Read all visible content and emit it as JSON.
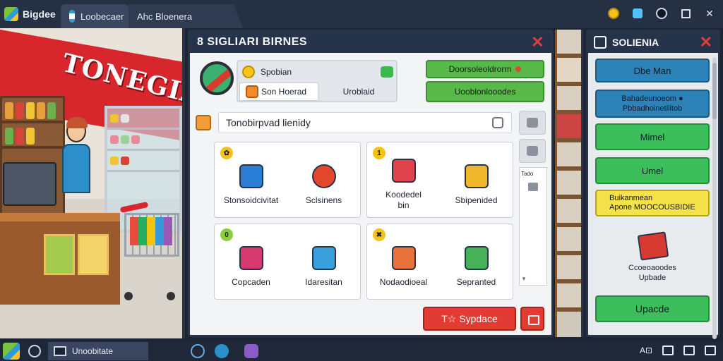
{
  "window": {
    "app_name": "Bigdee",
    "tabs": [
      {
        "label": "Loobecaer"
      },
      {
        "label": "Ahc Bloenera"
      }
    ],
    "controls": [
      "coin-icon",
      "puzzle-icon",
      "moon-icon",
      "maximize-icon",
      "close-icon"
    ]
  },
  "scene": {
    "store_sign": "TONEGIANA"
  },
  "dialog": {
    "title": "8 SIGLIARI BIRNES",
    "info": {
      "row1": "Spobian",
      "seg_active": "Son Hoerad",
      "seg_inactive": "Uroblaid"
    },
    "buttons": {
      "top": "Doorsoleoldrorm",
      "second": "Uooblonlooodes"
    },
    "search": {
      "value": "Tonobirpvad lienidy"
    },
    "cards": [
      {
        "badge": "✿",
        "items": [
          {
            "label": "Stonsoidcivitat",
            "icon": "cart-icon",
            "color": "#2a7fd4"
          },
          {
            "label": "Sclsinens",
            "icon": "flower-icon",
            "color": "#e2462c"
          }
        ]
      },
      {
        "badge": "1",
        "items": [
          {
            "label": "Koodedel\nbin",
            "icon": "box-icon",
            "color": "#e0434b"
          },
          {
            "label": "Sbipenided",
            "icon": "books-icon",
            "color": "#f1b72b"
          }
        ]
      },
      {
        "badge": "0",
        "items": [
          {
            "label": "Copcaden",
            "icon": "cube-icon",
            "color": "#d63a6e"
          },
          {
            "label": "Idaresitan",
            "icon": "bucket-icon",
            "color": "#3aa0dc"
          }
        ]
      },
      {
        "badge": "✖",
        "items": [
          {
            "label": "Nodaodioeal",
            "icon": "frame-icon",
            "color": "#e8733a"
          },
          {
            "label": "Sepranted",
            "icon": "pointer-icon",
            "color": "#46b05a"
          }
        ]
      }
    ],
    "side_panel_label": "Tado",
    "action_button": "T☆ Sypdace"
  },
  "rpanel": {
    "title": "SOLIENIA",
    "buttons": [
      {
        "label": "Dbe Man"
      },
      {
        "label": "Bahadeunoeom ●",
        "sub": "Pbbadhoinetilitob"
      },
      {
        "label": "Mimel"
      },
      {
        "label": "Umel"
      },
      {
        "label": "Buikanmean",
        "sub": "Apone   MOOCOUSBIDIE"
      }
    ],
    "upgrade_caption_1": "Ccoeoaoodes",
    "upgrade_caption_2": "Upbade",
    "upgrade_button": "Upacde"
  },
  "taskbar": {
    "app_label": "Unoobitate",
    "tray_text": "A⊡"
  }
}
